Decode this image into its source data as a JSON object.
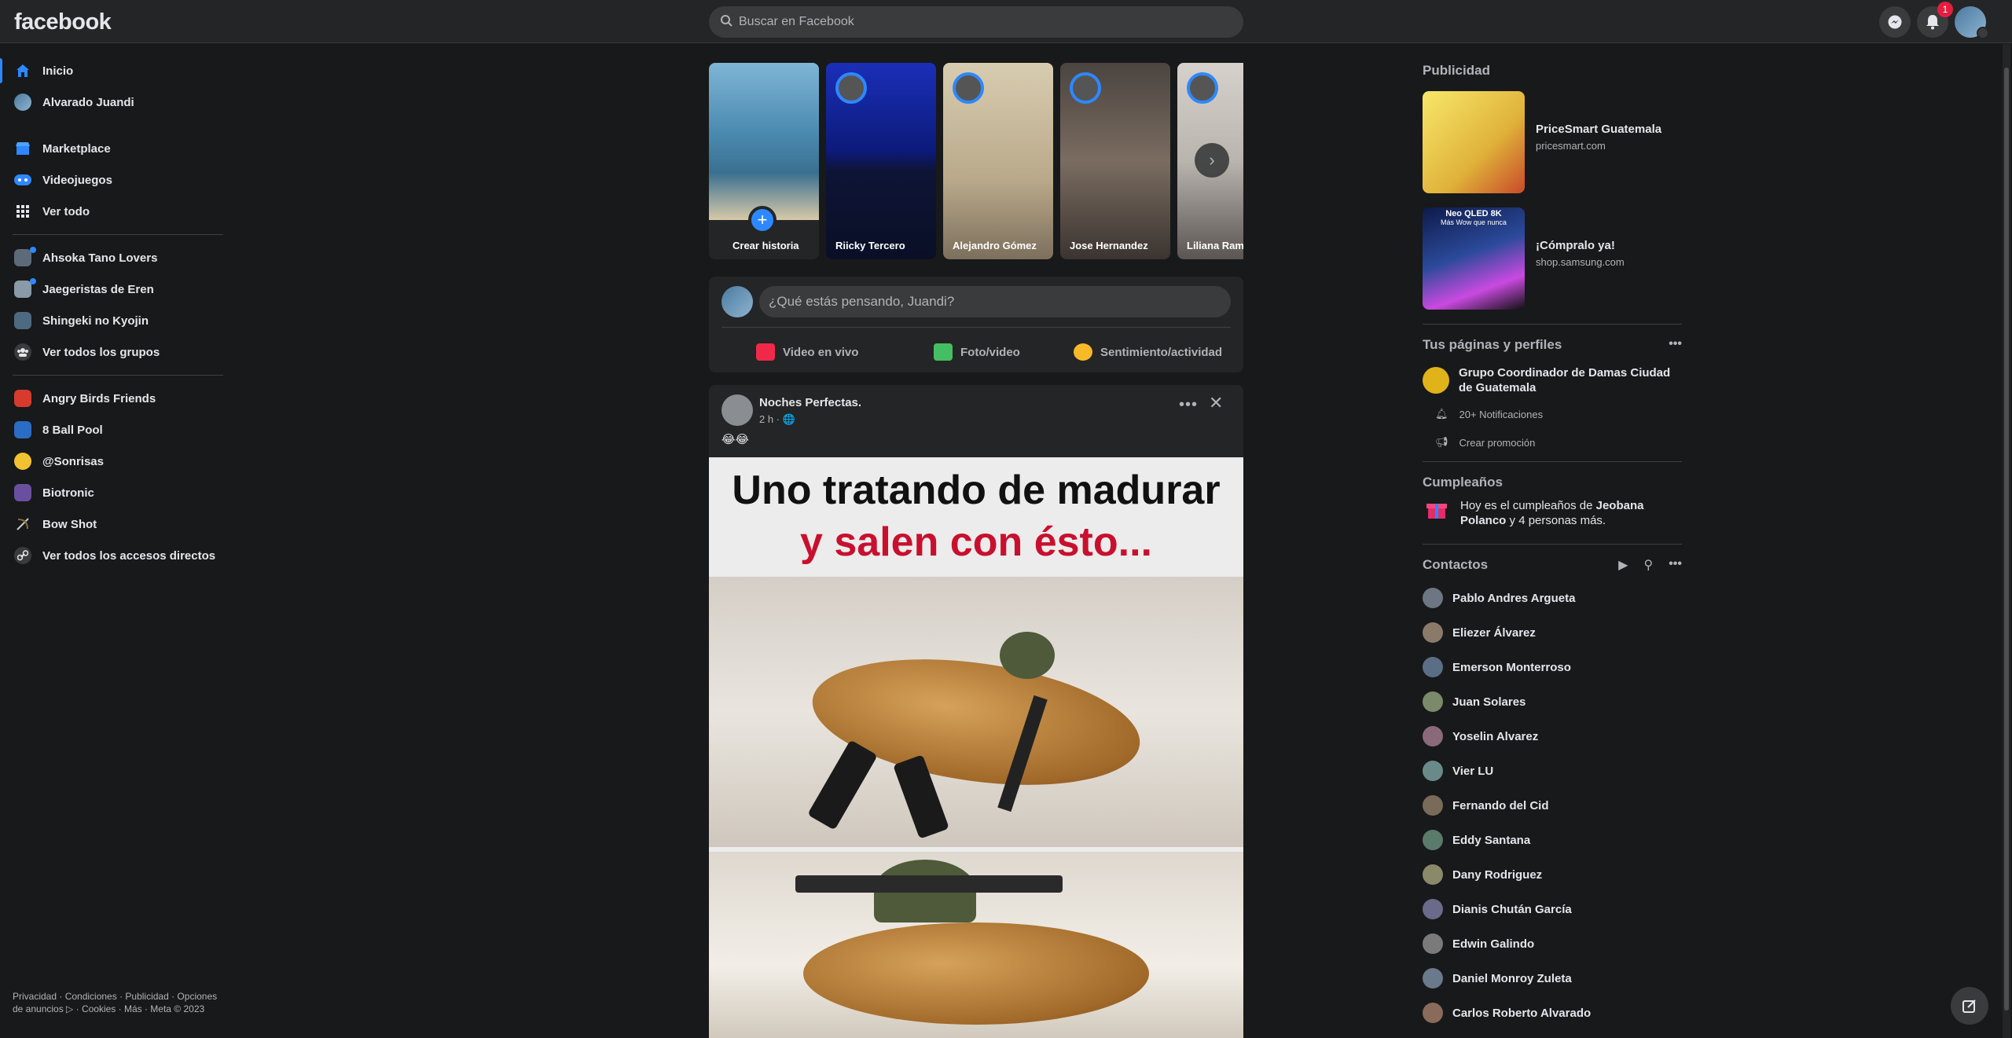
{
  "topbar": {
    "logo": "facebook",
    "search_placeholder": "Buscar en Facebook",
    "notifications_count": "1"
  },
  "left_nav": {
    "items": [
      {
        "label": "Inicio",
        "icon": "home-icon",
        "color": "#2d88ff"
      },
      {
        "label": "Alvarado Juandi",
        "icon": "avatar",
        "color": "#6a8fb0"
      },
      {
        "label": "Marketplace",
        "icon": "marketplace-icon",
        "color": "#2d88ff"
      },
      {
        "label": "Videojuegos",
        "icon": "gaming-icon",
        "color": "#2d88ff"
      },
      {
        "label": "Ver todo",
        "icon": "grid-icon",
        "color": "#3a3b3c"
      }
    ],
    "groups": [
      {
        "label": "Ahsoka Tano Lovers",
        "color": "#5d6a7a"
      },
      {
        "label": "Jaegeristas de Eren",
        "color": "#8a9aa8"
      },
      {
        "label": "Shingeki no Kyojin",
        "color": "#4e6a80"
      },
      {
        "label": "Ver todos los grupos",
        "color": "#3a3b3c"
      }
    ],
    "shortcuts": [
      {
        "label": "Angry Birds Friends",
        "color": "#d63b2e"
      },
      {
        "label": "8 Ball Pool",
        "color": "#2b6cc4"
      },
      {
        "label": "@Sonrisas",
        "color": "#f2c230"
      },
      {
        "label": "Biotronic",
        "color": "#6a4fa0"
      },
      {
        "label": "Bow Shot",
        "color": "#3a3b3c"
      },
      {
        "label": "Ver todos los accesos directos",
        "color": "#3a3b3c"
      }
    ],
    "footer": "Privacidad · Condiciones · Publicidad · Opciones de anuncios ▷ · Cookies · Más · Meta © 2023"
  },
  "stories": [
    {
      "label": "Crear historia",
      "color": "#4a8ab0"
    },
    {
      "label": "Riicky Tercero",
      "color": "#1b2fb8"
    },
    {
      "label": "Alejandro Gómez",
      "color": "#c7b79a"
    },
    {
      "label": "Jose Hernandez",
      "color": "#7a6c60"
    },
    {
      "label": "Liliana Ramir",
      "color": "#b9b4ae"
    }
  ],
  "composer": {
    "placeholder": "¿Qué estás pensando, Juandi?",
    "actions": [
      {
        "label": "Video en vivo",
        "color": "#f02849"
      },
      {
        "label": "Foto/video",
        "color": "#45bd62"
      },
      {
        "label": "Sentimiento/actividad",
        "color": "#f7b928"
      }
    ]
  },
  "post": {
    "author": "Noches Perfectas.",
    "meta": "2 h · 🌐",
    "text": "😂😂",
    "meme_line1": "Uno tratando de madurar",
    "meme_line2": "y salen con ésto..."
  },
  "right": {
    "ads_title": "Publicidad",
    "ads": [
      {
        "title": "PriceSmart Guatemala",
        "domain": "pricesmart.com",
        "color": "#e8d84a"
      },
      {
        "title": "¡Cómpralo ya!",
        "domain": "shop.samsung.com",
        "color": "#2b4a9a"
      }
    ],
    "ad2_overlay_1": "Neo QLED 8K",
    "ad2_overlay_2": "Más Wow que nunca",
    "pages_title": "Tus páginas y perfiles",
    "page_name": "Grupo Coordinador de Damas Ciudad de Guatemala",
    "page_notifications": "20+ Notificaciones",
    "page_promo": "Crear promoción",
    "birthdays_title": "Cumpleaños",
    "birthday_text_1": "Hoy es el cumpleaños de ",
    "birthday_name": "Jeobana Polanco",
    "birthday_text_2": " y 4 personas más.",
    "contacts_title": "Contactos",
    "contacts": [
      "Pablo Andres Argueta",
      "Eliezer Álvarez",
      "Emerson Monterroso",
      "Juan Solares",
      "Yoselin Alvarez",
      "Vier LU",
      "Fernando del Cid",
      "Eddy Santana",
      "Dany Rodriguez",
      "Dianis Chután García",
      "Edwin Galindo",
      "Daniel Monroy Zuleta",
      "Carlos Roberto Alvarado"
    ]
  }
}
